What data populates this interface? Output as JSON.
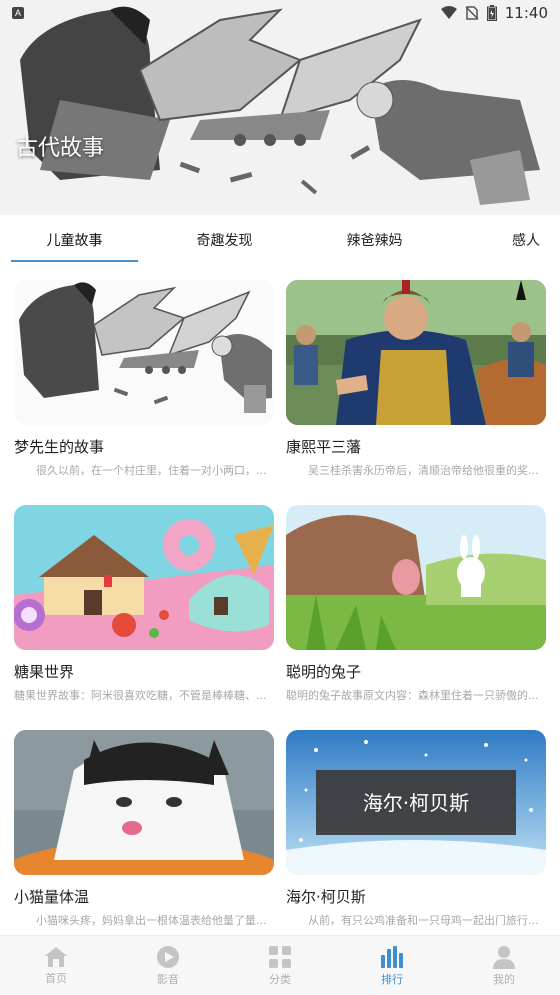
{
  "status_bar": {
    "time": "11:40"
  },
  "banner": {
    "title": "古代故事"
  },
  "tabs": [
    {
      "label": "儿童故事",
      "active": true
    },
    {
      "label": "奇趣发现",
      "active": false
    },
    {
      "label": "辣爸辣妈",
      "active": false
    },
    {
      "label": "感人",
      "active": false
    }
  ],
  "stories": [
    {
      "title": "梦先生的故事",
      "desc": "很久以前，在一个村庄里，住着一对小两口，..."
    },
    {
      "title": "康熙平三藩",
      "desc": "吴三桂杀害永历帝后，清顺治帝给他很重的奖..."
    },
    {
      "title": "糖果世界",
      "desc": "糖果世界故事：阿米很喜欢吃糖，不管是棒棒糖、..."
    },
    {
      "title": "聪明的兔子",
      "desc": "聪明的兔子故事原文内容：森林里住着一只骄傲的..."
    },
    {
      "title": "小猫量体温",
      "desc": "小猫咪头疼，妈妈拿出一根体温表给他量了量..."
    },
    {
      "title": "海尔·柯贝斯",
      "desc": "从前，有只公鸡准备和一只母鸡一起出门旅行..."
    }
  ],
  "thumb_texts": {
    "haier_sign": "海尔·柯贝斯"
  },
  "bottom_nav": [
    {
      "label": "首页",
      "icon": "home-icon",
      "active": false
    },
    {
      "label": "影音",
      "icon": "play-icon",
      "active": false
    },
    {
      "label": "分类",
      "icon": "grid-icon",
      "active": false
    },
    {
      "label": "排行",
      "icon": "bar-chart-icon",
      "active": true
    },
    {
      "label": "我的",
      "icon": "user-icon",
      "active": false
    }
  ],
  "colors": {
    "accent": "#3d8fd0",
    "inactive": "#b0b0b0"
  }
}
